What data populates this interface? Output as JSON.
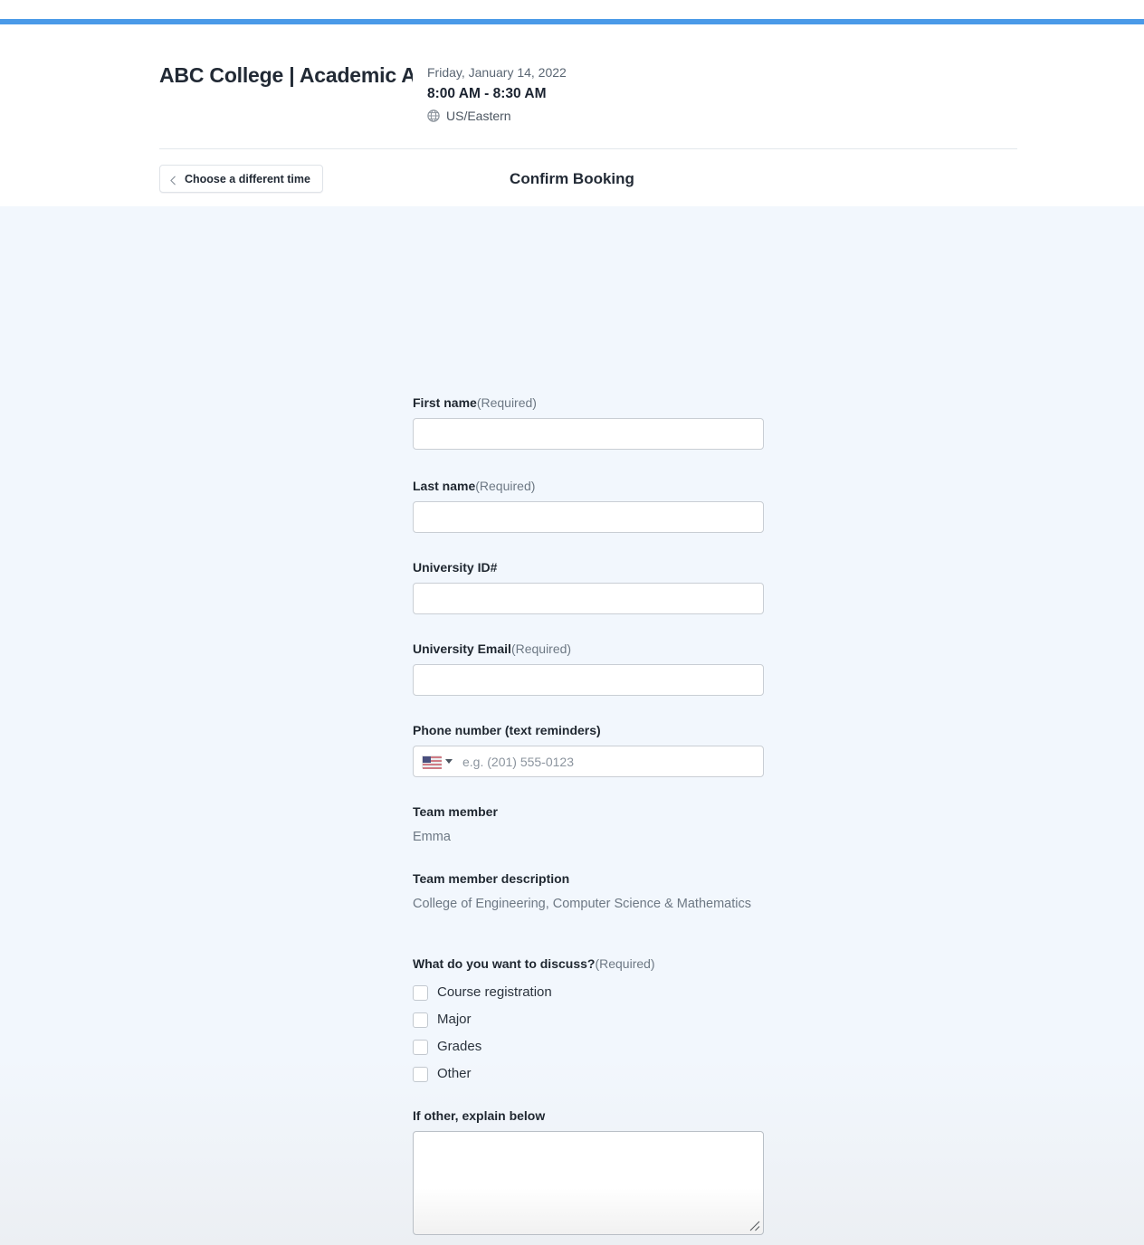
{
  "theme": {
    "accent_color": "#4a9ae8",
    "body_background": "#f2f7fd",
    "text_color": "#222a35",
    "muted_text_color": "#6d7884",
    "input_border_color": "#c9ced4"
  },
  "header": {
    "brand_title": "ABC College | Academic Advising",
    "back_button_label": "Choose a different time",
    "back_icon": "chevron-left-icon",
    "page_heading": "Confirm Booking"
  },
  "booking_card": {
    "date": "Friday, January 14, 2022",
    "time_range": "8:00 AM - 8:30 AM",
    "timezone": "US/Eastern",
    "timezone_icon": "globe-icon"
  },
  "form": {
    "required_suffix": "(Required)",
    "first_name": {
      "label": "First name",
      "required": true,
      "value": "",
      "placeholder": ""
    },
    "last_name": {
      "label": "Last name",
      "required": true,
      "value": "",
      "placeholder": ""
    },
    "university_id": {
      "label": "University ID#",
      "required": false,
      "value": "",
      "placeholder": ""
    },
    "university_email": {
      "label": "University Email",
      "required": true,
      "value": "",
      "placeholder": ""
    },
    "phone": {
      "label": "Phone number (text reminders)",
      "required": false,
      "value": "",
      "placeholder": "e.g. (201) 555-0123",
      "country_flag": "us-flag-icon",
      "country_caret": "caret-down-icon"
    },
    "team_member": {
      "label": "Team member",
      "value": "Emma"
    },
    "team_member_description": {
      "label": "Team member description",
      "value": "College of Engineering, Computer Science & Mathematics"
    },
    "discuss": {
      "label": "What do you want to discuss?",
      "required": true,
      "options": [
        {
          "label": "Course registration",
          "checked": false
        },
        {
          "label": "Major",
          "checked": false
        },
        {
          "label": "Grades",
          "checked": false
        },
        {
          "label": "Other",
          "checked": false
        }
      ]
    },
    "other_explain": {
      "label": "If other, explain below",
      "value": "",
      "placeholder": ""
    }
  }
}
